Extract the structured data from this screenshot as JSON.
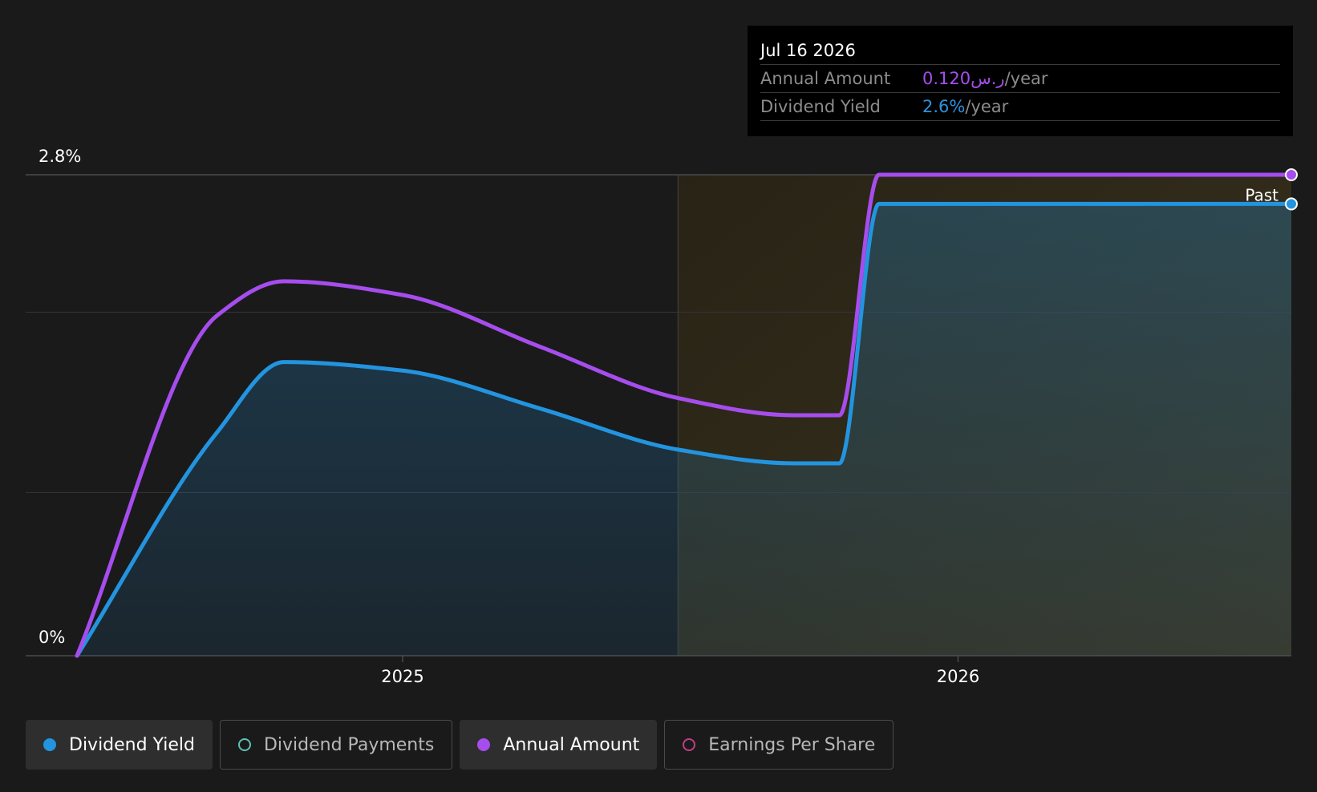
{
  "tooltip": {
    "date": "Jul 16 2026",
    "rows": [
      {
        "label": "Annual Amount",
        "value": "0.120ر.س",
        "unit": "/year",
        "color": "#a64ded"
      },
      {
        "label": "Dividend Yield",
        "value": "2.6%",
        "unit": "/year",
        "color": "#2d92df"
      }
    ]
  },
  "past_label": "Past",
  "legend": [
    {
      "label": "Dividend Yield",
      "color": "#2394df",
      "filled": true,
      "active": true
    },
    {
      "label": "Dividend Payments",
      "color": "#5ec2b5",
      "filled": false,
      "active": false
    },
    {
      "label": "Annual Amount",
      "color": "#a64ded",
      "filled": true,
      "active": true
    },
    {
      "label": "Earnings Per Share",
      "color": "#c23f85",
      "filled": false,
      "active": false
    }
  ],
  "chart_data": {
    "type": "line",
    "title": "",
    "xlabel": "",
    "ylabel": "",
    "x_ticks": [
      "2025",
      "2026"
    ],
    "y_ticks": [
      "0%",
      "2.8%"
    ],
    "ylim": [
      0,
      2.8
    ],
    "xlim": [
      "2024-06-01",
      "2026-08-08"
    ],
    "grid": true,
    "past_divider_date": "2025-07-01",
    "series": [
      {
        "name": "Dividend Yield",
        "color": "#2394df",
        "fill": true,
        "x": [
          "2024-06-01",
          "2024-09-01",
          "2024-10-15",
          "2025-01-01",
          "2025-04-01",
          "2025-07-01",
          "2025-09-15",
          "2025-10-15",
          "2025-11-10",
          "2026-08-08"
        ],
        "y": [
          0.0,
          1.3,
          1.71,
          1.66,
          1.44,
          1.2,
          1.12,
          1.12,
          2.63,
          2.63
        ]
      },
      {
        "name": "Annual Amount",
        "color": "#a64ded",
        "fill": false,
        "x": [
          "2024-06-01",
          "2024-09-01",
          "2024-10-15",
          "2025-01-01",
          "2025-04-01",
          "2025-07-01",
          "2025-09-15",
          "2025-10-15",
          "2025-11-10",
          "2026-08-08"
        ],
        "y": [
          0.0,
          1.98,
          2.18,
          2.1,
          1.8,
          1.5,
          1.4,
          1.4,
          2.8,
          2.8
        ]
      }
    ]
  }
}
